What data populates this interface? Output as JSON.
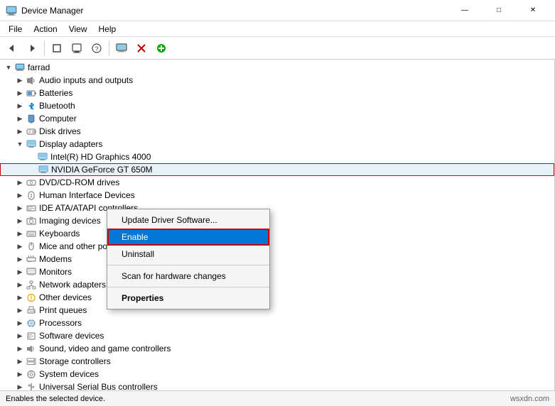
{
  "window": {
    "title": "Device Manager",
    "icon": "🖥️"
  },
  "titlebar": {
    "minimize": "—",
    "maximize": "□",
    "close": "✕"
  },
  "menubar": {
    "items": [
      "File",
      "Action",
      "View",
      "Help"
    ]
  },
  "toolbar": {
    "buttons": [
      "◀",
      "▶",
      "⬛",
      "⬛",
      "❓",
      "⬛",
      "🖥️",
      "✕",
      "⊕"
    ]
  },
  "tree": {
    "root": {
      "label": "farrad",
      "expanded": true
    },
    "items": [
      {
        "id": "audio",
        "label": "Audio inputs and outputs",
        "indent": 1,
        "expanded": false,
        "icon": "audio"
      },
      {
        "id": "batteries",
        "label": "Batteries",
        "indent": 1,
        "expanded": false,
        "icon": "battery"
      },
      {
        "id": "bluetooth",
        "label": "Bluetooth",
        "indent": 1,
        "expanded": false,
        "icon": "bluetooth"
      },
      {
        "id": "computer",
        "label": "Computer",
        "indent": 1,
        "expanded": false,
        "icon": "computer"
      },
      {
        "id": "diskdrives",
        "label": "Disk drives",
        "indent": 1,
        "expanded": false,
        "icon": "drive"
      },
      {
        "id": "displayadapters",
        "label": "Display adapters",
        "indent": 1,
        "expanded": true,
        "icon": "display"
      },
      {
        "id": "intel",
        "label": "Intel(R) HD Graphics 4000",
        "indent": 2,
        "expanded": false,
        "icon": "display"
      },
      {
        "id": "nvidia",
        "label": "NVIDIA GeForce GT 650M",
        "indent": 2,
        "expanded": false,
        "icon": "display",
        "selected": true,
        "highlighted": true
      },
      {
        "id": "dvd",
        "label": "DVD/CD-ROM drives",
        "indent": 1,
        "expanded": false,
        "icon": "drive"
      },
      {
        "id": "hid",
        "label": "Human Interface Devices",
        "indent": 1,
        "expanded": false,
        "icon": "hid"
      },
      {
        "id": "ide",
        "label": "IDE ATA/ATAPI controllers",
        "indent": 1,
        "expanded": false,
        "icon": "drive"
      },
      {
        "id": "imaging",
        "label": "Imaging devices",
        "indent": 1,
        "expanded": false,
        "icon": "camera"
      },
      {
        "id": "keyboards",
        "label": "Keyboards",
        "indent": 1,
        "expanded": false,
        "icon": "keyboard"
      },
      {
        "id": "mice",
        "label": "Mice and other pointing devices",
        "indent": 1,
        "expanded": false,
        "icon": "mouse"
      },
      {
        "id": "modems",
        "label": "Modems",
        "indent": 1,
        "expanded": false,
        "icon": "modem"
      },
      {
        "id": "monitors",
        "label": "Monitors",
        "indent": 1,
        "expanded": false,
        "icon": "monitor"
      },
      {
        "id": "network",
        "label": "Network adapters",
        "indent": 1,
        "expanded": false,
        "icon": "network"
      },
      {
        "id": "other",
        "label": "Other devices",
        "indent": 1,
        "expanded": false,
        "icon": "other"
      },
      {
        "id": "print",
        "label": "Print queues",
        "indent": 1,
        "expanded": false,
        "icon": "print"
      },
      {
        "id": "processors",
        "label": "Processors",
        "indent": 1,
        "expanded": false,
        "icon": "processor"
      },
      {
        "id": "software",
        "label": "Software devices",
        "indent": 1,
        "expanded": false,
        "icon": "software"
      },
      {
        "id": "sound",
        "label": "Sound, video and game controllers",
        "indent": 1,
        "expanded": false,
        "icon": "audio"
      },
      {
        "id": "storage",
        "label": "Storage controllers",
        "indent": 1,
        "expanded": false,
        "icon": "drive"
      },
      {
        "id": "system",
        "label": "System devices",
        "indent": 1,
        "expanded": false,
        "icon": "system"
      },
      {
        "id": "usb",
        "label": "Universal Serial Bus controllers",
        "indent": 1,
        "expanded": false,
        "icon": "usb"
      }
    ]
  },
  "contextmenu": {
    "items": [
      {
        "id": "update",
        "label": "Update Driver Software...",
        "type": "normal"
      },
      {
        "id": "enable",
        "label": "Enable",
        "type": "active"
      },
      {
        "id": "uninstall",
        "label": "Uninstall",
        "type": "normal"
      },
      {
        "id": "sep1",
        "type": "separator"
      },
      {
        "id": "scan",
        "label": "Scan for hardware changes",
        "type": "normal"
      },
      {
        "id": "sep2",
        "type": "separator"
      },
      {
        "id": "properties",
        "label": "Properties",
        "type": "bold"
      }
    ]
  },
  "statusbar": {
    "text": "Enables the selected device.",
    "right": "wsxdn.com"
  }
}
